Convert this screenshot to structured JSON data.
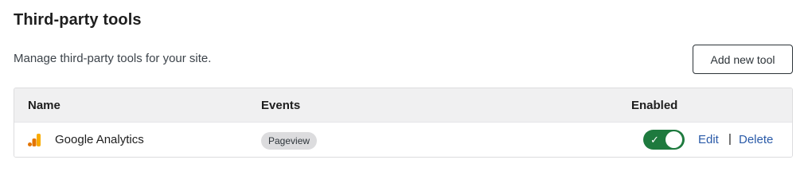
{
  "section": {
    "title": "Third-party tools",
    "description": "Manage third-party tools for your site.",
    "add_button_label": "Add new tool"
  },
  "table": {
    "headers": {
      "name": "Name",
      "events": "Events",
      "enabled": "Enabled"
    },
    "rows": [
      {
        "icon": "google-analytics-icon",
        "name": "Google Analytics",
        "event": "Pageview",
        "enabled": true,
        "edit_label": "Edit",
        "separator": "|",
        "delete_label": "Delete"
      }
    ]
  },
  "colors": {
    "toggle_on": "#1e7a3e",
    "link": "#2a5aa8",
    "header_bg": "#f0f0f1",
    "analytics_orange": "#f9ab00",
    "analytics_dark_orange": "#e37400"
  }
}
